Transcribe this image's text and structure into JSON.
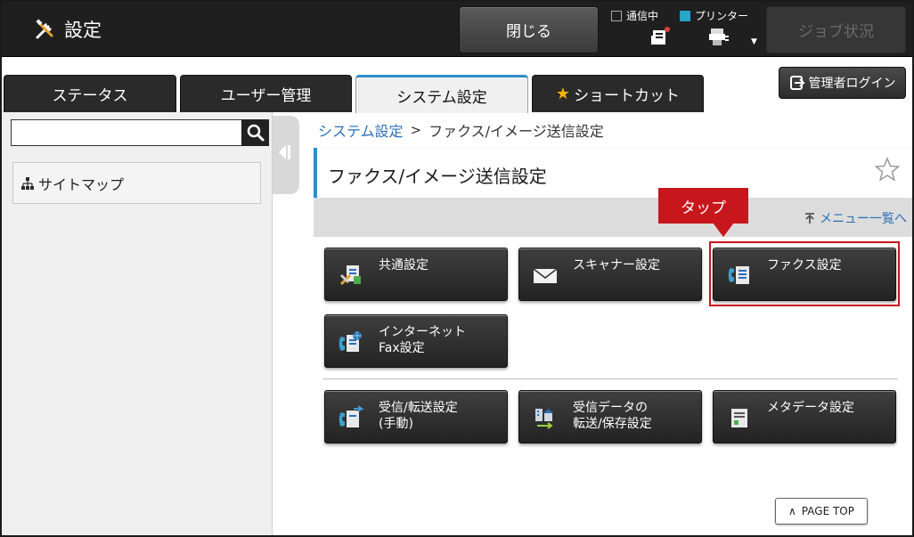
{
  "header": {
    "title": "設定",
    "close_label": "閉じる",
    "status": {
      "comm_label": "通信中",
      "printer_label": "プリンター"
    },
    "job_status_label": "ジョブ状況"
  },
  "tabs": [
    {
      "label": "ステータス"
    },
    {
      "label": "ユーザー管理"
    },
    {
      "label": "システム設定"
    },
    {
      "label": "ショートカット"
    }
  ],
  "admin_login_label": "管理者ログイン",
  "sidebar": {
    "search": {
      "value": "",
      "placeholder": ""
    },
    "sitemap_label": "サイトマップ"
  },
  "breadcrumb": {
    "parent": "システム設定",
    "separator": ">",
    "current": "ファクス/イメージ送信設定"
  },
  "page": {
    "title": "ファクス/イメージ送信設定",
    "menu_list_label": "メニュー一覧へ",
    "tap_callout": "タップ"
  },
  "menu_buttons": {
    "common": {
      "line1": "共通設定",
      "line2": ""
    },
    "scanner": {
      "line1": "スキャナー設定",
      "line2": ""
    },
    "fax": {
      "line1": "ファクス設定",
      "line2": ""
    },
    "internet_fax": {
      "line1": "インターネット",
      "line2": "Fax設定"
    },
    "receive": {
      "line1": "受信/転送設定",
      "line2": "(手動)"
    },
    "received_data": {
      "line1": "受信データの",
      "line2": "転送/保存設定"
    },
    "metadata": {
      "line1": "メタデータ設定",
      "line2": ""
    }
  },
  "page_top_label": "PAGE TOP",
  "colors": {
    "accent": "#2f8fc6",
    "callout": "#c8161d",
    "link": "#2a6fb6",
    "star": "#f5b400"
  }
}
